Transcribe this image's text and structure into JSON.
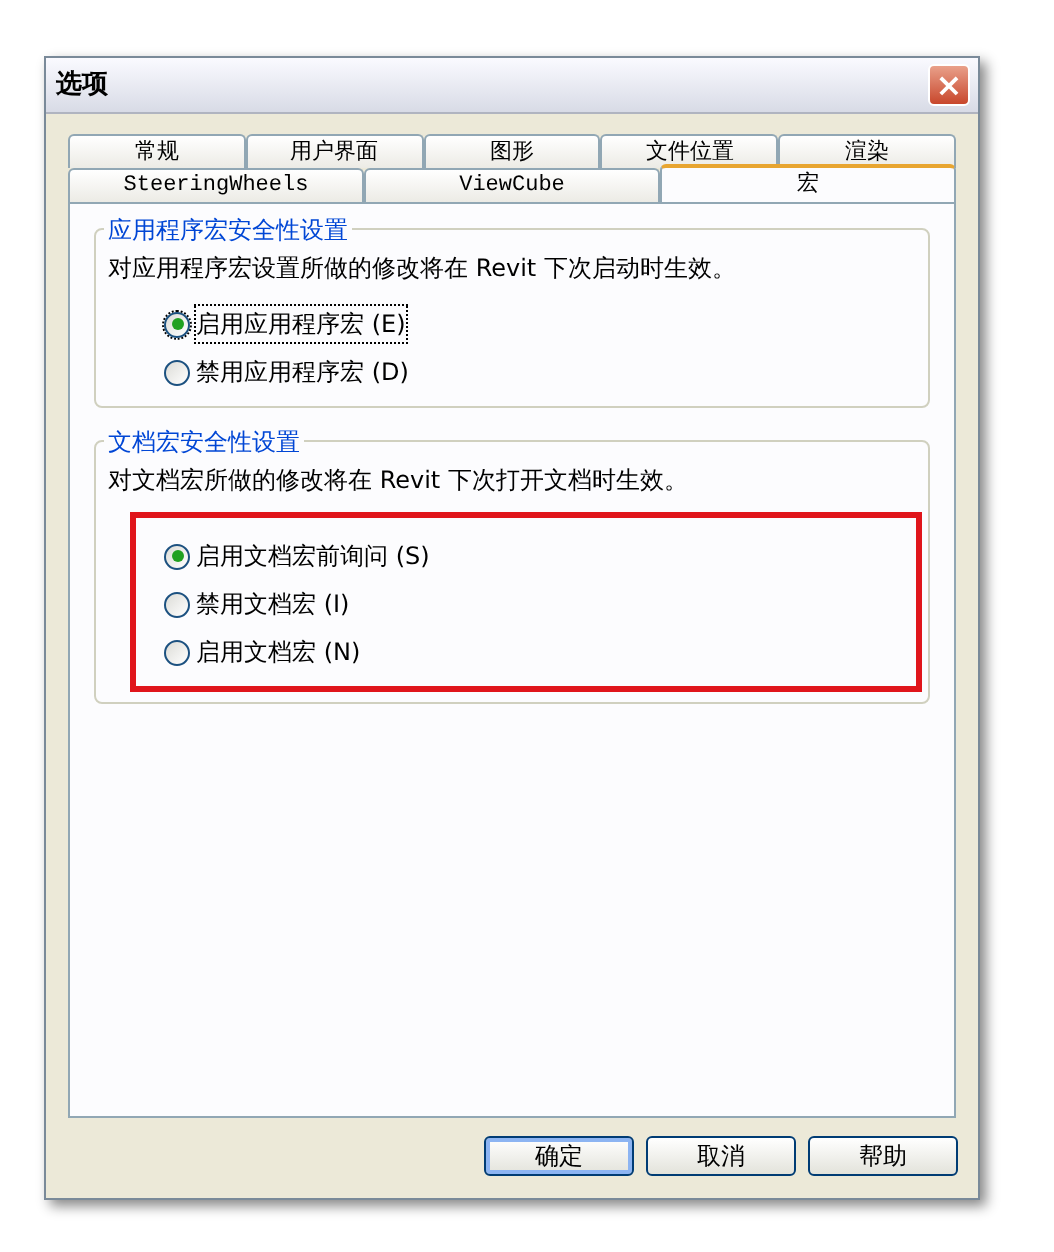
{
  "window": {
    "title": "选项",
    "close": "×"
  },
  "tab_rows": [
    [
      {
        "label": "常规",
        "selected": false
      },
      {
        "label": "用户界面",
        "selected": false
      },
      {
        "label": "图形",
        "selected": false
      },
      {
        "label": "文件位置",
        "selected": false
      },
      {
        "label": "渲染",
        "selected": false
      }
    ],
    [
      {
        "label": "SteeringWheels",
        "selected": false
      },
      {
        "label": "ViewCube",
        "selected": false
      },
      {
        "label": "宏",
        "selected": true
      }
    ]
  ],
  "groups": [
    {
      "title": "应用程序宏安全性设置",
      "description": "对应用程序宏设置所做的修改将在 Revit 下次启动时生效。",
      "highlighted": false,
      "options": [
        {
          "label": "启用应用程序宏 (E)",
          "selected": true,
          "focused": true
        },
        {
          "label": "禁用应用程序宏 (D)",
          "selected": false,
          "focused": false
        }
      ]
    },
    {
      "title": "文档宏安全性设置",
      "description": "对文档宏所做的修改将在 Revit 下次打开文档时生效。",
      "highlighted": true,
      "options": [
        {
          "label": "启用文档宏前询问 (S)",
          "selected": true,
          "focused": false
        },
        {
          "label": "禁用文档宏 (I)",
          "selected": false,
          "focused": false
        },
        {
          "label": "启用文档宏 (N)",
          "selected": false,
          "focused": false
        }
      ]
    }
  ],
  "buttons": [
    {
      "label": "确定",
      "default": true
    },
    {
      "label": "取消",
      "default": false
    },
    {
      "label": "帮助",
      "default": false
    }
  ]
}
